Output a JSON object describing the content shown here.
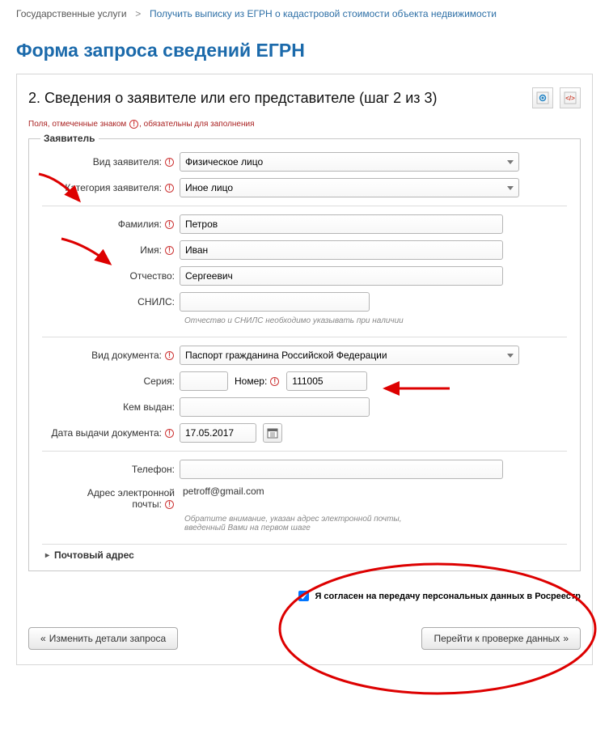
{
  "breadcrumb": {
    "root": "Государственные услуги",
    "leaf": "Получить выписку из ЕГРН о кадастровой стоимости объекта недвижимости"
  },
  "page_title": "Форма запроса сведений ЕГРН",
  "step_title": "2. Сведения о заявителе или его представителе (шаг 2 из 3)",
  "required_note_prefix": "Поля, отмеченные знаком",
  "required_note_suffix": "обязательны для заполнения",
  "fieldset_legend": "Заявитель",
  "labels": {
    "applicant_type": "Вид заявителя:",
    "applicant_category": "Категория заявителя:",
    "surname": "Фамилия:",
    "name": "Имя:",
    "patronymic": "Отчество:",
    "snils": "СНИЛС:",
    "doc_type": "Вид документа:",
    "series": "Серия:",
    "number": "Номер:",
    "issued_by": "Кем выдан:",
    "issue_date": "Дата выдачи документа:",
    "phone": "Телефон:",
    "email": "Адрес электронной почты:"
  },
  "values": {
    "applicant_type": "Физическое лицо",
    "applicant_category": "Иное лицо",
    "surname": "Петров",
    "name": "Иван",
    "patronymic": "Сергеевич",
    "snils": "",
    "doc_type": "Паспорт гражданина Российской Федерации",
    "series": "",
    "number": "111005",
    "issued_by": "",
    "issue_date": "17.05.2017",
    "phone": "",
    "email": "petroff@gmail.com"
  },
  "hint_name": "Отчество и СНИЛС необходимо указывать при наличии",
  "hint_email": "Обратите внимание, указан адрес электронной почты, введенный Вами на первом шаге",
  "collapse_label": "Почтовый адрес",
  "consent_label": "Я согласен на передачу персональных данных в Росреестр",
  "btn_back": "Изменить детали запроса",
  "btn_forward": "Перейти к проверке данных"
}
